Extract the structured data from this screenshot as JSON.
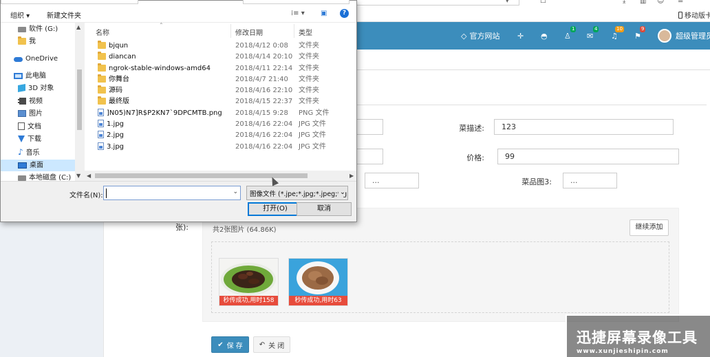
{
  "browser": {
    "mobile_tab_label": "移动版卡"
  },
  "navbar": {
    "website_link": "官方网站",
    "badges": {
      "users": "1",
      "messages": "4",
      "notifications": "10",
      "flags": "9"
    },
    "user_name": "超级管理员"
  },
  "form": {
    "dish_desc_label": "菜描述:",
    "dish_desc_value": "123",
    "price_label": "价格:",
    "price_value": "99",
    "dish_image3_label": "菜品图3:",
    "browse_placeholder_1": "...",
    "browse_placeholder_2": "...",
    "images_label_tail": "张):",
    "upload_info": "共2张图片 (64.86K)",
    "add_more_button": "继续添加",
    "thumbnails": [
      {
        "status": "秒传成功,用时158"
      },
      {
        "status": "秒传成功,用时63"
      }
    ],
    "save_button": "保 存",
    "close_button": "关 闭"
  },
  "watermark": {
    "title": "迅捷屏幕录像工具",
    "url": "www.xunjieshipin.com"
  },
  "dialog": {
    "toolbar": {
      "organize": "组织 ▾",
      "new_folder": "新建文件夹"
    },
    "tree": [
      {
        "label": "软件 (G:)",
        "icon": "drive"
      },
      {
        "label": "我",
        "icon": "folder"
      },
      {
        "label": "OneDrive",
        "icon": "cloud"
      },
      {
        "label": "此电脑",
        "icon": "pc"
      },
      {
        "label": "3D 对象",
        "icon": "cube"
      },
      {
        "label": "视频",
        "icon": "film"
      },
      {
        "label": "图片",
        "icon": "image"
      },
      {
        "label": "文档",
        "icon": "doc"
      },
      {
        "label": "下载",
        "icon": "down"
      },
      {
        "label": "音乐",
        "icon": "music"
      },
      {
        "label": "桌面",
        "icon": "desk"
      },
      {
        "label": "本地磁盘 (C:)",
        "icon": "drive"
      }
    ],
    "columns": {
      "name": "名称",
      "date": "修改日期",
      "type": "类型"
    },
    "files": [
      {
        "name": "bjqun",
        "date": "2018/4/12 0:08",
        "type": "文件夹",
        "icon": "folder"
      },
      {
        "name": "diancan",
        "date": "2018/4/14 20:10",
        "type": "文件夹",
        "icon": "folder"
      },
      {
        "name": "ngrok-stable-windows-amd64",
        "date": "2018/4/11 22:14",
        "type": "文件夹",
        "icon": "folder"
      },
      {
        "name": "你舞台",
        "date": "2018/4/7 21:40",
        "type": "文件夹",
        "icon": "folder"
      },
      {
        "name": "源码",
        "date": "2018/4/16 22:10",
        "type": "文件夹",
        "icon": "folder"
      },
      {
        "name": "最终版",
        "date": "2018/4/15 22:37",
        "type": "文件夹",
        "icon": "folder"
      },
      {
        "name": "]N05)N7]R$P2KN7`9DPCMTB.png",
        "date": "2018/4/15 9:28",
        "type": "PNG 文件",
        "icon": "file"
      },
      {
        "name": "1.jpg",
        "date": "2018/4/16 22:04",
        "type": "JPG 文件",
        "icon": "file"
      },
      {
        "name": "2.jpg",
        "date": "2018/4/16 22:04",
        "type": "JPG 文件",
        "icon": "file"
      },
      {
        "name": "3.jpg",
        "date": "2018/4/16 22:04",
        "type": "JPG 文件",
        "icon": "file"
      }
    ],
    "filename_label": "文件名(N):",
    "filename_value": "",
    "filter_value": "图像文件 (*.jpe;*.jpg;*.jpeg;*.gif)",
    "open_button": "打开(O)",
    "cancel_button": "取消"
  },
  "colors": {
    "navbar": "#3c8dbc",
    "status_red": "#e74c3c",
    "selection": "#cce8ff"
  }
}
